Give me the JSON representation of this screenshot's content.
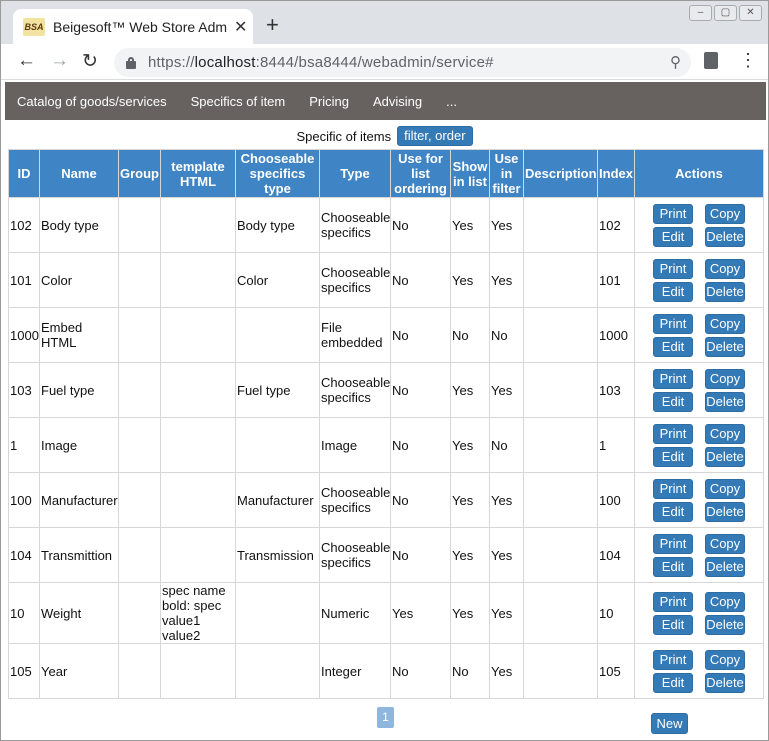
{
  "browser": {
    "tab_title": "Beigesoft™ Web Store Adm",
    "favicon_text": "BSA",
    "url_scheme": "https://",
    "url_host": "localhost",
    "url_rest": ":8444/bsa8444/webadmin/service#"
  },
  "appnav": {
    "items": [
      "Catalog of goods/services",
      "Specifics of item",
      "Pricing",
      "Advising",
      "..."
    ]
  },
  "heading": {
    "title": "Specific of items",
    "filter_button": "filter, order"
  },
  "table": {
    "headers": {
      "id": "ID",
      "name": "Name",
      "group": "Group",
      "template": "template HTML",
      "chooseable": "Chooseable specifics type",
      "type": "Type",
      "use_list": "Use for list ordering",
      "show_list": "Show in list",
      "use_filter": "Use in filter",
      "description": "Description",
      "index": "Index",
      "actions": "Actions"
    },
    "action_labels": {
      "print": "Print",
      "copy": "Copy",
      "edit": "Edit",
      "delete": "Delete"
    },
    "rows": [
      {
        "id": "102",
        "name": "Body type",
        "group": "",
        "template": "",
        "chooseable": "Body type",
        "type": "Chooseable specifics",
        "use_list": "No",
        "show_list": "Yes",
        "use_filter": "Yes",
        "description": "",
        "index": "102"
      },
      {
        "id": "101",
        "name": "Color",
        "group": "",
        "template": "",
        "chooseable": "Color",
        "type": "Chooseable specifics",
        "use_list": "No",
        "show_list": "Yes",
        "use_filter": "Yes",
        "description": "",
        "index": "101"
      },
      {
        "id": "1000",
        "name": "Embed HTML",
        "group": "",
        "template": "",
        "chooseable": "",
        "type": "File embedded",
        "use_list": "No",
        "show_list": "No",
        "use_filter": "No",
        "description": "",
        "index": "1000"
      },
      {
        "id": "103",
        "name": "Fuel type",
        "group": "",
        "template": "",
        "chooseable": "Fuel type",
        "type": "Chooseable specifics",
        "use_list": "No",
        "show_list": "Yes",
        "use_filter": "Yes",
        "description": "",
        "index": "103"
      },
      {
        "id": "1",
        "name": "Image",
        "group": "",
        "template": "",
        "chooseable": "",
        "type": "Image",
        "use_list": "No",
        "show_list": "Yes",
        "use_filter": "No",
        "description": "",
        "index": "1"
      },
      {
        "id": "100",
        "name": "Manufacturer",
        "group": "",
        "template": "",
        "chooseable": "Manufacturer",
        "type": "Chooseable specifics",
        "use_list": "No",
        "show_list": "Yes",
        "use_filter": "Yes",
        "description": "",
        "index": "100"
      },
      {
        "id": "104",
        "name": "Transmittion",
        "group": "",
        "template": "",
        "chooseable": "Transmission",
        "type": "Chooseable specifics",
        "use_list": "No",
        "show_list": "Yes",
        "use_filter": "Yes",
        "description": "",
        "index": "104"
      },
      {
        "id": "10",
        "name": "Weight",
        "group": "",
        "template": "spec name bold: spec value1 value2",
        "chooseable": "",
        "type": "Numeric",
        "use_list": "Yes",
        "show_list": "Yes",
        "use_filter": "Yes",
        "description": "",
        "index": "10"
      },
      {
        "id": "105",
        "name": "Year",
        "group": "",
        "template": "",
        "chooseable": "",
        "type": "Integer",
        "use_list": "No",
        "show_list": "No",
        "use_filter": "Yes",
        "description": "",
        "index": "105"
      }
    ]
  },
  "pagination": {
    "current_page": "1"
  },
  "footer": {
    "new_button": "New"
  }
}
